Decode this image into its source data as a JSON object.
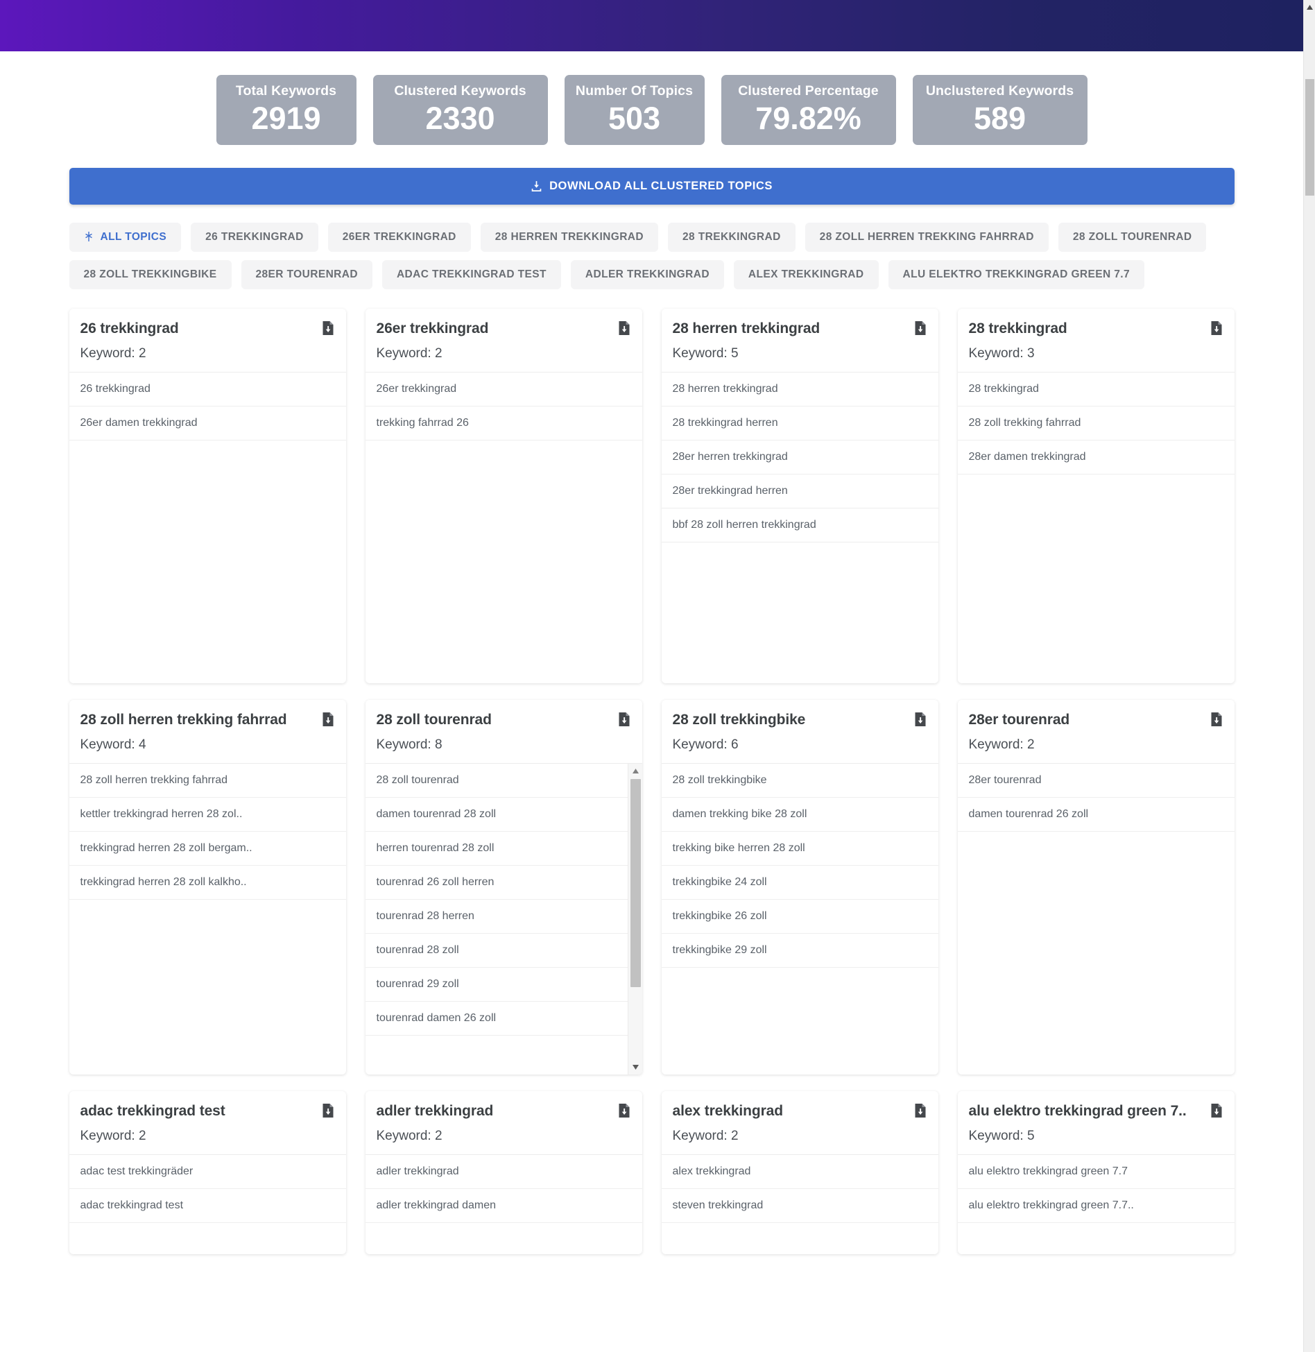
{
  "header": {
    "bar_color_left": "#5c17bc",
    "bar_color_right": "#1e2260"
  },
  "stats": [
    {
      "label": "Total Keywords",
      "value": "2919"
    },
    {
      "label": "Clustered Keywords",
      "value": "2330"
    },
    {
      "label": "Number Of Topics",
      "value": "503"
    },
    {
      "label": "Clustered Percentage",
      "value": "79.82%"
    },
    {
      "label": "Unclustered Keywords",
      "value": "589"
    }
  ],
  "toolbar": {
    "download_all_label": "DOWNLOAD ALL CLUSTERED TOPICS",
    "download_icon": "download-icon",
    "accent_color": "#3f6fce"
  },
  "filters": {
    "active_index": 0,
    "chips": [
      {
        "label": "ALL TOPICS",
        "icon": "asterisk-icon",
        "active": true
      },
      {
        "label": "26 TREKKINGRAD",
        "active": false
      },
      {
        "label": "26ER TREKKINGRAD",
        "active": false
      },
      {
        "label": "28 HERREN TREKKINGRAD",
        "active": false
      },
      {
        "label": "28 TREKKINGRAD",
        "active": false
      },
      {
        "label": "28 ZOLL HERREN TREKKING FAHRRAD",
        "active": false
      },
      {
        "label": "28 ZOLL TOURENRAD",
        "active": false
      },
      {
        "label": "28 ZOLL TREKKINGBIKE",
        "active": false
      },
      {
        "label": "28ER TOURENRAD",
        "active": false
      },
      {
        "label": "ADAC TREKKINGRAD TEST",
        "active": false
      },
      {
        "label": "ADLER TREKKINGRAD",
        "active": false
      },
      {
        "label": "ALEX TREKKINGRAD",
        "active": false
      },
      {
        "label": "ALU ELEKTRO TREKKINGRAD GREEN 7.7",
        "active": false
      }
    ]
  },
  "keyword_label_prefix": "Keyword: ",
  "topics": [
    {
      "title": "26 trekkingrad",
      "count": "Keyword: 2",
      "scroll": false,
      "keywords": [
        "26 trekkingrad",
        "26er damen trekkingrad"
      ]
    },
    {
      "title": "26er trekkingrad",
      "count": "Keyword: 2",
      "scroll": false,
      "keywords": [
        "26er trekkingrad",
        "trekking fahrrad 26"
      ]
    },
    {
      "title": "28 herren trekkingrad",
      "count": "Keyword: 5",
      "scroll": false,
      "keywords": [
        "28 herren trekkingrad",
        "28 trekkingrad herren",
        "28er herren trekkingrad",
        "28er trekkingrad herren",
        "bbf 28 zoll herren trekkingrad"
      ]
    },
    {
      "title": "28 trekkingrad",
      "count": "Keyword: 3",
      "scroll": false,
      "keywords": [
        "28 trekkingrad",
        "28 zoll trekking fahrrad",
        "28er damen trekkingrad"
      ]
    },
    {
      "title": "28 zoll herren trekking fahrrad",
      "count": "Keyword: 4",
      "scroll": false,
      "keywords": [
        "28 zoll herren trekking fahrrad",
        "kettler trekkingrad herren 28 zol..",
        "trekkingrad herren 28 zoll bergam..",
        "trekkingrad herren 28 zoll kalkho.."
      ]
    },
    {
      "title": "28 zoll tourenrad",
      "count": "Keyword: 8",
      "scroll": true,
      "keywords": [
        "28 zoll tourenrad",
        "damen tourenrad 28 zoll",
        "herren tourenrad 28 zoll",
        "tourenrad 26 zoll herren",
        "tourenrad 28 herren",
        "tourenrad 28 zoll",
        "tourenrad 29 zoll",
        "tourenrad damen 26 zoll"
      ]
    },
    {
      "title": "28 zoll trekkingbike",
      "count": "Keyword: 6",
      "scroll": false,
      "keywords": [
        "28 zoll trekkingbike",
        "damen trekking bike 28 zoll",
        "trekking bike herren 28 zoll",
        "trekkingbike 24 zoll",
        "trekkingbike 26 zoll",
        "trekkingbike 29 zoll"
      ]
    },
    {
      "title": "28er tourenrad",
      "count": "Keyword: 2",
      "scroll": false,
      "keywords": [
        "28er tourenrad",
        "damen tourenrad 26 zoll"
      ]
    },
    {
      "title": "adac trekkingrad test",
      "count": "Keyword: 2",
      "scroll": false,
      "keywords": [
        "adac test trekkingräder",
        "adac trekkingrad test"
      ]
    },
    {
      "title": "adler trekkingrad",
      "count": "Keyword: 2",
      "scroll": false,
      "keywords": [
        "adler trekkingrad",
        "adler trekkingrad damen"
      ]
    },
    {
      "title": "alex trekkingrad",
      "count": "Keyword: 2",
      "scroll": false,
      "keywords": [
        "alex trekkingrad",
        "steven trekkingrad"
      ]
    },
    {
      "title": "alu elektro trekkingrad green 7..",
      "count": "Keyword: 5",
      "scroll": false,
      "keywords": [
        "alu elektro trekkingrad green 7.7",
        "alu elektro trekkingrad green 7.7.."
      ]
    }
  ]
}
